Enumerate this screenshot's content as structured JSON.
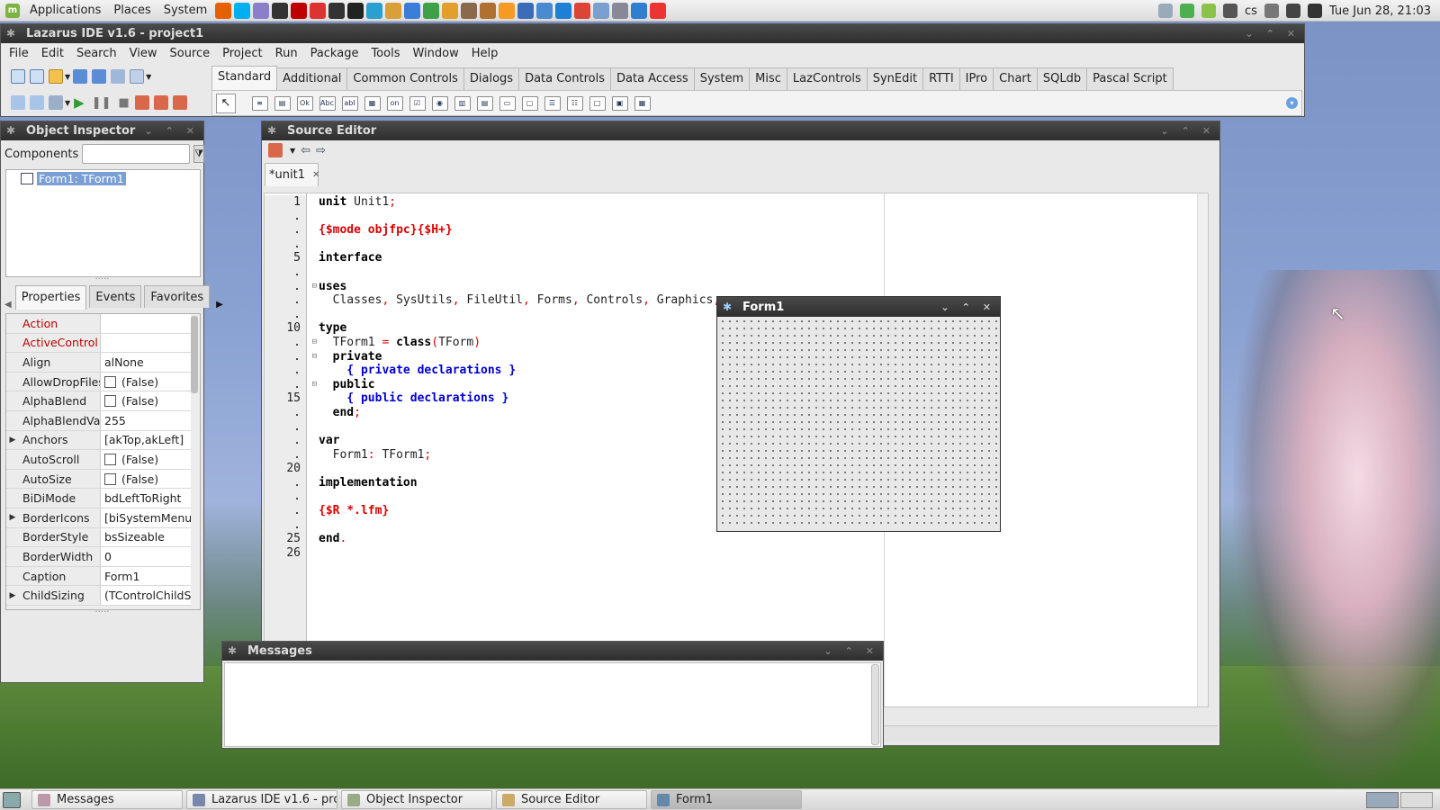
{
  "top_panel": {
    "menus": [
      "Applications",
      "Places",
      "System"
    ],
    "launchers": [
      "firefox-icon",
      "skype-icon",
      "pidgin-icon",
      "notepadqq-icon",
      "filezilla-icon",
      "xorg-icon",
      "terminal-small-icon",
      "terminal-icon",
      "vpn-icon",
      "file-manager-icon",
      "writer-icon",
      "calc-icon",
      "impress-icon",
      "gimp-icon",
      "archive-icon",
      "sun-icon",
      "globe-icon",
      "puzzle-icon",
      "vscode-icon",
      "chrome-icon",
      "gear-icon",
      "database-icon",
      "kodi-icon",
      "flag-icon"
    ],
    "tray_keyboard": "cs",
    "clock": "Tue Jun 28, 21:03"
  },
  "main_window": {
    "title": "Lazarus IDE v1.6 - project1",
    "menu": [
      "File",
      "Edit",
      "Search",
      "View",
      "Source",
      "Project",
      "Run",
      "Package",
      "Tools",
      "Window",
      "Help"
    ],
    "palette_tabs": [
      "Standard",
      "Additional",
      "Common Controls",
      "Dialogs",
      "Data Controls",
      "Data Access",
      "System",
      "Misc",
      "LazControls",
      "SynEdit",
      "RTTI",
      "IPro",
      "Chart",
      "SQLdb",
      "Pascal Script"
    ],
    "palette_selected": "Standard",
    "palette_components": [
      {
        "name": "main-menu-component",
        "glyph": "≡"
      },
      {
        "name": "popup-menu-component",
        "glyph": "▤"
      },
      {
        "name": "button-component",
        "glyph": "Ok"
      },
      {
        "name": "label-component",
        "glyph": "Abc"
      },
      {
        "name": "edit-component",
        "glyph": "abI"
      },
      {
        "name": "memo-component",
        "glyph": "▦"
      },
      {
        "name": "toggle-box-component",
        "glyph": "on"
      },
      {
        "name": "checkbox-component",
        "glyph": "☑"
      },
      {
        "name": "radio-button-component",
        "glyph": "◉"
      },
      {
        "name": "listbox-component",
        "glyph": "▥"
      },
      {
        "name": "combobox-component",
        "glyph": "▤"
      },
      {
        "name": "scrollbar-component",
        "glyph": "▭"
      },
      {
        "name": "groupbox-component",
        "glyph": "▢"
      },
      {
        "name": "radio-group-component",
        "glyph": "☰"
      },
      {
        "name": "checkgroup-component",
        "glyph": "☷"
      },
      {
        "name": "panel-component",
        "glyph": "□"
      },
      {
        "name": "frame-component",
        "glyph": "▣"
      },
      {
        "name": "action-list-component",
        "glyph": "▦"
      }
    ]
  },
  "object_inspector": {
    "title": "Object Inspector",
    "components_label": "Components",
    "filter_value": "",
    "tree_item": "Form1: TForm1",
    "tabs": [
      "Properties",
      "Events",
      "Favorites"
    ],
    "selected_tab": "Properties",
    "properties": [
      {
        "name": "Action",
        "value": "",
        "red": true,
        "checkbox": false,
        "expandable": false
      },
      {
        "name": "ActiveControl",
        "value": "",
        "red": true,
        "checkbox": false,
        "expandable": false
      },
      {
        "name": "Align",
        "value": "alNone",
        "red": false,
        "checkbox": false,
        "expandable": false
      },
      {
        "name": "AllowDropFiles",
        "value": "(False)",
        "red": false,
        "checkbox": true,
        "expandable": false
      },
      {
        "name": "AlphaBlend",
        "value": "(False)",
        "red": false,
        "checkbox": true,
        "expandable": false
      },
      {
        "name": "AlphaBlendValu",
        "value": "255",
        "red": false,
        "checkbox": false,
        "expandable": false
      },
      {
        "name": "Anchors",
        "value": "[akTop,akLeft]",
        "red": false,
        "checkbox": false,
        "expandable": true
      },
      {
        "name": "AutoScroll",
        "value": "(False)",
        "red": false,
        "checkbox": true,
        "expandable": false
      },
      {
        "name": "AutoSize",
        "value": "(False)",
        "red": false,
        "checkbox": true,
        "expandable": false
      },
      {
        "name": "BiDiMode",
        "value": "bdLeftToRight",
        "red": false,
        "checkbox": false,
        "expandable": false
      },
      {
        "name": "BorderIcons",
        "value": "[biSystemMenu,b",
        "red": false,
        "checkbox": false,
        "expandable": true
      },
      {
        "name": "BorderStyle",
        "value": "bsSizeable",
        "red": false,
        "checkbox": false,
        "expandable": false
      },
      {
        "name": "BorderWidth",
        "value": "0",
        "red": false,
        "checkbox": false,
        "expandable": false
      },
      {
        "name": "Caption",
        "value": "Form1",
        "red": false,
        "checkbox": false,
        "expandable": false
      },
      {
        "name": "ChildSizing",
        "value": "(TControlChildSiz",
        "red": false,
        "checkbox": false,
        "expandable": true
      }
    ]
  },
  "source_editor": {
    "title": "Source Editor",
    "tab": "*unit1",
    "lines": [
      {
        "gutter": "1",
        "fold": "",
        "tokens": [
          {
            "t": "unit",
            "c": "kw"
          },
          {
            "t": " Unit1",
            "c": ""
          },
          {
            "t": ";",
            "c": "sym"
          }
        ]
      },
      {
        "gutter": ".",
        "fold": "",
        "tokens": []
      },
      {
        "gutter": ".",
        "fold": "",
        "tokens": [
          {
            "t": "{$mode objfpc}{$H+}",
            "c": "dir"
          }
        ]
      },
      {
        "gutter": ".",
        "fold": "",
        "tokens": []
      },
      {
        "gutter": "5",
        "fold": "",
        "tokens": [
          {
            "t": "interface",
            "c": "kw"
          }
        ]
      },
      {
        "gutter": ".",
        "fold": "",
        "tokens": []
      },
      {
        "gutter": ".",
        "fold": "⊟",
        "tokens": [
          {
            "t": "uses",
            "c": "kw"
          }
        ]
      },
      {
        "gutter": ".",
        "fold": "",
        "tokens": [
          {
            "t": "  Classes",
            "c": ""
          },
          {
            "t": ",",
            "c": "sym"
          },
          {
            "t": " SysUtils",
            "c": ""
          },
          {
            "t": ",",
            "c": "sym"
          },
          {
            "t": " FileUtil",
            "c": ""
          },
          {
            "t": ",",
            "c": "sym"
          },
          {
            "t": " Forms",
            "c": ""
          },
          {
            "t": ",",
            "c": "sym"
          },
          {
            "t": " Controls",
            "c": ""
          },
          {
            "t": ",",
            "c": "sym"
          },
          {
            "t": " Graphics",
            "c": ""
          },
          {
            "t": ",",
            "c": "sym"
          }
        ]
      },
      {
        "gutter": ".",
        "fold": "",
        "tokens": []
      },
      {
        "gutter": "10",
        "fold": "",
        "tokens": [
          {
            "t": "type",
            "c": "kw"
          }
        ]
      },
      {
        "gutter": ".",
        "fold": "⊟",
        "tokens": [
          {
            "t": "  TForm1 ",
            "c": ""
          },
          {
            "t": "=",
            "c": "sym"
          },
          {
            "t": " ",
            "c": ""
          },
          {
            "t": "class",
            "c": "kw"
          },
          {
            "t": "(",
            "c": "sym"
          },
          {
            "t": "TForm",
            "c": ""
          },
          {
            "t": ")",
            "c": "sym"
          }
        ]
      },
      {
        "gutter": ".",
        "fold": "⊟",
        "tokens": [
          {
            "t": "  private",
            "c": "kw"
          }
        ]
      },
      {
        "gutter": ".",
        "fold": "",
        "tokens": [
          {
            "t": "    { private declarations }",
            "c": "cmt"
          }
        ]
      },
      {
        "gutter": ".",
        "fold": "⊟",
        "tokens": [
          {
            "t": "  public",
            "c": "kw"
          }
        ]
      },
      {
        "gutter": "15",
        "fold": "",
        "tokens": [
          {
            "t": "    { public declarations }",
            "c": "cmt"
          }
        ]
      },
      {
        "gutter": ".",
        "fold": "",
        "tokens": [
          {
            "t": "  end",
            "c": "kw"
          },
          {
            "t": ";",
            "c": "sym"
          }
        ]
      },
      {
        "gutter": ".",
        "fold": "",
        "tokens": []
      },
      {
        "gutter": ".",
        "fold": "",
        "tokens": [
          {
            "t": "var",
            "c": "kw"
          }
        ]
      },
      {
        "gutter": ".",
        "fold": "",
        "tokens": [
          {
            "t": "  Form1",
            "c": ""
          },
          {
            "t": ":",
            "c": "sym"
          },
          {
            "t": " TForm1",
            "c": ""
          },
          {
            "t": ";",
            "c": "sym"
          }
        ]
      },
      {
        "gutter": "20",
        "fold": "",
        "tokens": []
      },
      {
        "gutter": ".",
        "fold": "",
        "tokens": [
          {
            "t": "implementation",
            "c": "kw"
          }
        ]
      },
      {
        "gutter": ".",
        "fold": "",
        "tokens": []
      },
      {
        "gutter": ".",
        "fold": "",
        "tokens": [
          {
            "t": "{$R *.lfm}",
            "c": "dir"
          }
        ]
      },
      {
        "gutter": ".",
        "fold": "",
        "tokens": []
      },
      {
        "gutter": "25",
        "fold": "",
        "tokens": [
          {
            "t": "end",
            "c": "kw"
          },
          {
            "t": ".",
            "c": "sym"
          }
        ]
      },
      {
        "gutter": "26",
        "fold": "",
        "tokens": []
      }
    ]
  },
  "messages_window": {
    "title": "Messages"
  },
  "form1_window": {
    "title": "Form1"
  },
  "taskbar": [
    {
      "label": "Messages",
      "active": false,
      "icon": "messages-icon"
    },
    {
      "label": "Lazarus IDE v1.6 - pro...",
      "active": false,
      "icon": "lazarus-icon"
    },
    {
      "label": "Object Inspector",
      "active": false,
      "icon": "object-inspector-icon"
    },
    {
      "label": "Source Editor",
      "active": false,
      "icon": "source-editor-icon"
    },
    {
      "label": "Form1",
      "active": true,
      "icon": "form-icon"
    }
  ]
}
